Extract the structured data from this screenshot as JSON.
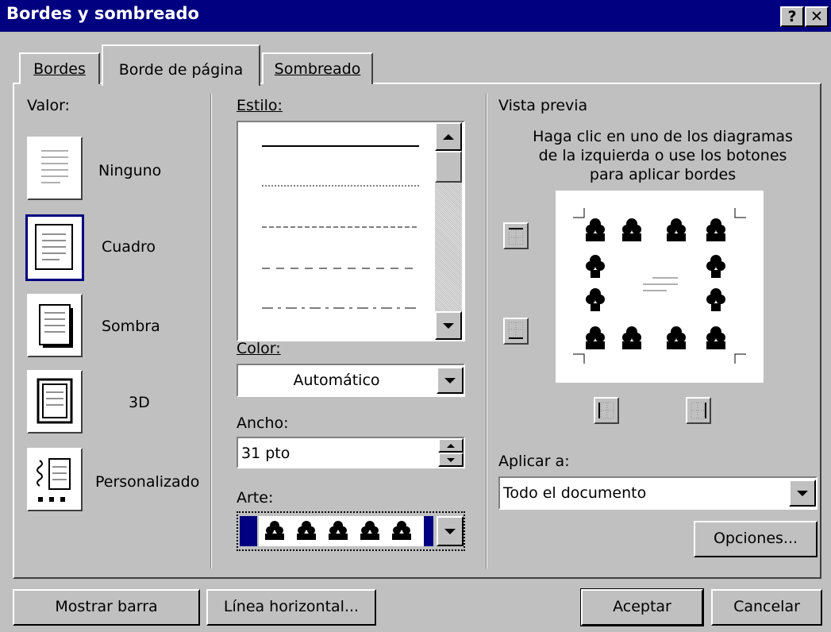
{
  "window": {
    "title": "Bordes y sombreado",
    "help_btn": "?",
    "close_btn": "✕"
  },
  "tabs": [
    {
      "label": "Bordes",
      "active": false
    },
    {
      "label": "Borde de página",
      "active": true
    },
    {
      "label": "Sombreado",
      "active": false
    }
  ],
  "valor": {
    "label": "Valor:",
    "items": [
      {
        "label": "Ninguno"
      },
      {
        "label": "Cuadro"
      },
      {
        "label": "Sombra"
      },
      {
        "label": "3D"
      },
      {
        "label": "Personalizado"
      }
    ]
  },
  "estilo": {
    "label": "Estilo:"
  },
  "color": {
    "label": "Color:",
    "value": "Automático"
  },
  "ancho": {
    "label": "Ancho:",
    "value": "31 pto"
  },
  "arte": {
    "label": "Arte:"
  },
  "preview": {
    "label": "Vista previa",
    "hint_line1": "Haga clic en uno de los diagramas",
    "hint_line2": "de la izquierda o use los botones",
    "hint_line3": "para aplicar bordes"
  },
  "aplicar": {
    "label": "Aplicar a:",
    "value": "Todo el documento"
  },
  "buttons": {
    "opciones": "Opciones...",
    "mostrar_barra": "Mostrar barra",
    "linea_horizontal": "Línea horizontal...",
    "aceptar": "Aceptar",
    "cancelar": "Cancelar"
  },
  "colors": {
    "title_bar": "#000080",
    "face": "#c0c0c0",
    "selected_frame": "#000080"
  }
}
